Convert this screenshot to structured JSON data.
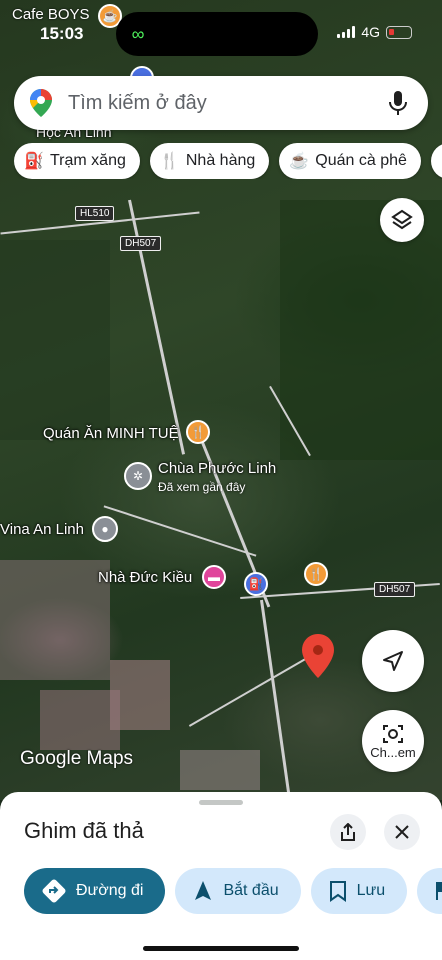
{
  "status": {
    "time": "15:03",
    "network": "4G",
    "top_label": "Cafe BOYS"
  },
  "search": {
    "placeholder": "Tìm kiếm ở đây"
  },
  "chips": [
    {
      "icon": "fuel-icon",
      "label": "Trạm xăng"
    },
    {
      "icon": "restaurant-icon",
      "label": "Nhà hàng"
    },
    {
      "icon": "coffee-icon",
      "label": "Quán cà phê"
    }
  ],
  "map": {
    "road_labels": [
      "HL510",
      "DH507",
      "DH507"
    ],
    "partial_label": "Học An Linh",
    "pois": [
      {
        "label": "Quán Ăn MINH TUỆ",
        "icon": "restaurant-icon",
        "color": "#f29b38"
      },
      {
        "label": "Chùa Phước Linh",
        "sub": "Đã xem gần đây",
        "icon": "temple-icon",
        "color": "#8a8f96"
      },
      {
        "label": "Vina An Linh",
        "icon": "place-icon",
        "color": "#8a8f96"
      },
      {
        "label": "Nhà Đức Kiều",
        "icon": "hotel-icon",
        "color": "#e0459b"
      },
      {
        "label": "",
        "icon": "fuel-icon",
        "color": "#4a6fe0"
      },
      {
        "label": "",
        "icon": "restaurant-icon",
        "color": "#f29b38"
      }
    ],
    "logo": "Google Maps",
    "lens_label": "Ch...em"
  },
  "sheet": {
    "title": "Ghim đã thả",
    "actions": [
      {
        "label": "Đường đi",
        "icon": "directions-icon"
      },
      {
        "label": "Bắt đầu",
        "icon": "navigation-icon"
      },
      {
        "label": "Lưu",
        "icon": "bookmark-icon"
      },
      {
        "label": "",
        "icon": "flag-icon"
      }
    ]
  },
  "colors": {
    "pin": "#ea4335",
    "primary_action": "#1a6b8a",
    "secondary_action": "#d3e8fb"
  }
}
